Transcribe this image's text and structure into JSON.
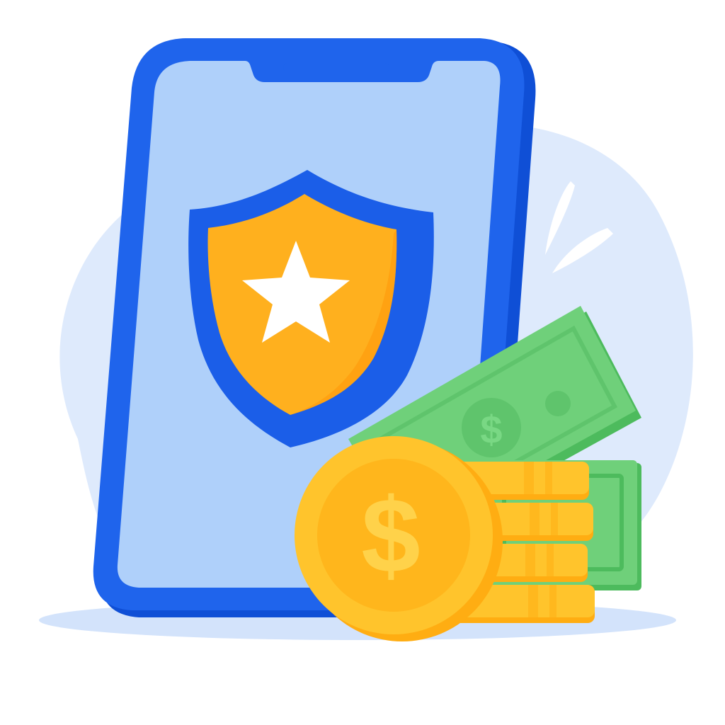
{
  "illustration": {
    "subject": "phone-with-shield-and-money",
    "icons": [
      "shield-icon",
      "star-icon",
      "banknote-icon",
      "coin-icon",
      "dollar-sign-icon",
      "sparkle-icon"
    ]
  },
  "colors": {
    "background_blob": "#deeafc",
    "ground_shadow": "#d3e3fb",
    "phone_body": "#1f64ec",
    "phone_body_dark": "#0f4fd6",
    "phone_screen": "#afd0fa",
    "shield_border": "#1b5ee8",
    "shield_fill": "#ffb01e",
    "shield_fill_dark": "#ff9a0a",
    "star": "#ffffff",
    "banknote": "#6fd07a",
    "banknote_dark": "#4dbb5d",
    "banknote_detail": "#5fc46c",
    "coin": "#ffc42c",
    "coin_dark": "#ffad12",
    "coin_face": "#ffb61c",
    "coin_symbol": "#ffd24a"
  }
}
